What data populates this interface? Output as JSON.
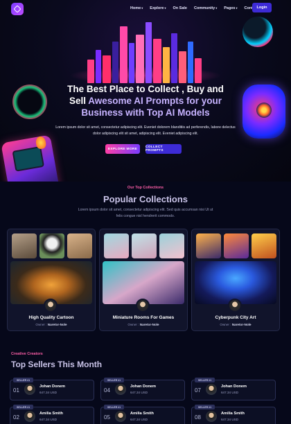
{
  "nav": {
    "items": [
      {
        "label": "Home",
        "dropdown": true
      },
      {
        "label": "Explore",
        "dropdown": true
      },
      {
        "label": "On Sale",
        "dropdown": false
      },
      {
        "label": "Community",
        "dropdown": true
      },
      {
        "label": "Pages",
        "dropdown": true
      },
      {
        "label": "Contact",
        "dropdown": false
      }
    ],
    "login_label": "Login",
    "caret": "▾"
  },
  "hero": {
    "title_line1": "The Best Place to Collect , Buy and",
    "title_line2_a": "Sell",
    "title_line2_b": "Awesome AI Prompts for your",
    "title_line3": "Business with Top AI Models",
    "subtitle": "Lorem ipsum dolor sit amet, consectetur adipiscing elit. Eveniet dolorem blanditiis ad perferendis, labore delectus dolor adipiscing elit sit amet, adipiscing elit. Eveniet adipiscing elit.",
    "explore_label": "EXPLORE MORE",
    "collect_label": "COLLECT PROMPTS"
  },
  "collections": {
    "kicker": "Our Top Collections",
    "title": "Popular Collections",
    "description": "Lorem ipsum dolor sit amet, consectetur adipiscing elit. Sed quis accumsan nisi Ut ut felis congue nisl hendrerit commodo.",
    "owner_prefix": "Owner :",
    "cards": [
      {
        "title": "High Quality Cartoon",
        "owner": "Naretor-Nole"
      },
      {
        "title": "Miniature Rooms For Games",
        "owner": "Naretor-Nole"
      },
      {
        "title": "Cyberpunk City Art",
        "owner": "Naretor-Nole"
      }
    ]
  },
  "sellers": {
    "kicker": "Creative Creators",
    "title": "Top Sellers This Month",
    "tag": "SELLER #1",
    "items": [
      {
        "num": "01",
        "name": "Johan Donem",
        "amount": "647.34 USD"
      },
      {
        "num": "04",
        "name": "Johan Donem",
        "amount": "647.34 USD"
      },
      {
        "num": "07",
        "name": "Johan Donem",
        "amount": "647.34 USD"
      },
      {
        "num": "02",
        "name": "Amilia Smith",
        "amount": "647.34 USD"
      },
      {
        "num": "05",
        "name": "Amilia Smith",
        "amount": "647.34 USD"
      },
      {
        "num": "08",
        "name": "Amilia Smith",
        "amount": "647.34 USD"
      }
    ]
  },
  "colors": {
    "background": "#06081a",
    "accent": "#3d2bd6",
    "pink": "#ff5fa8",
    "title_lavender": "#c7b3ff"
  }
}
